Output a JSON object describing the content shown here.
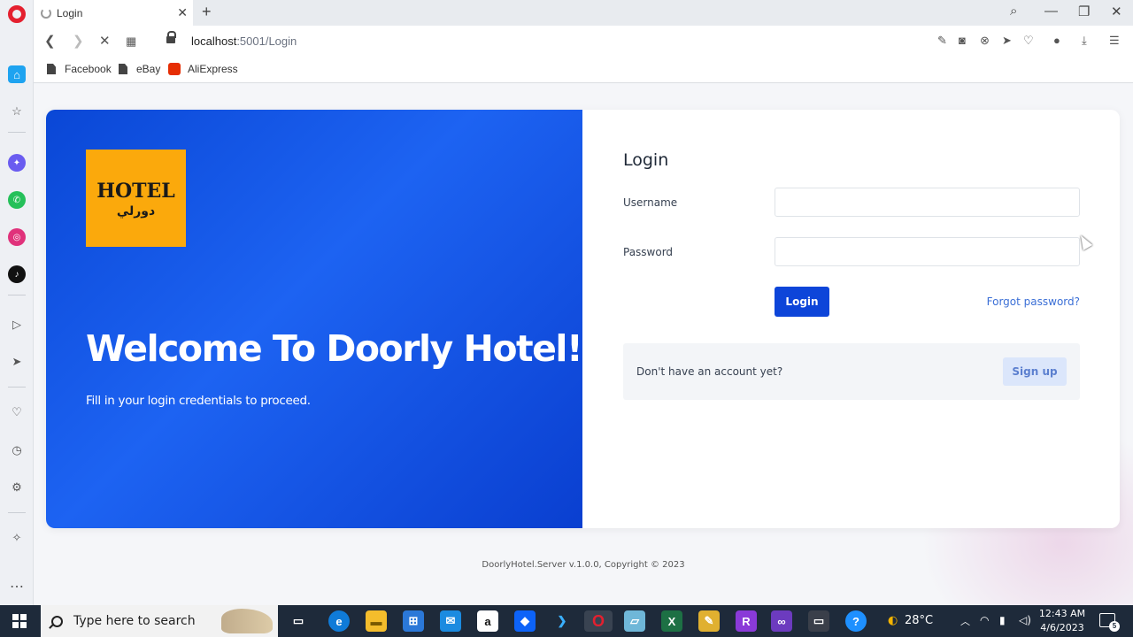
{
  "browser": {
    "tab_title": "Login",
    "url_host": "localhost",
    "url_path": ":5001/Login",
    "bookmarks": [
      "Facebook",
      "eBay",
      "AliExpress"
    ]
  },
  "logo": {
    "text": "HOTEL",
    "arabic": "دورلي"
  },
  "hero": {
    "title": "Welcome To Doorly Hotel!",
    "subtitle": "Fill in your login credentials to proceed."
  },
  "form": {
    "heading": "Login",
    "username_label": "Username",
    "username_value": "",
    "password_label": "Password",
    "password_value": "",
    "login_button": "Login",
    "forgot_link": "Forgot password?",
    "signup_prompt": "Don't have an account yet?",
    "signup_button": "Sign up"
  },
  "footer": "DoorlyHotel.Server v.1.0.0, Copyright © 2023",
  "taskbar": {
    "search_placeholder": "Type here to search",
    "temperature": "28°C",
    "time": "12:43 AM",
    "date": "4/6/2023",
    "notification_count": "5"
  },
  "colors": {
    "hero_blue": "#0a47d6",
    "login_button": "#0d45d9",
    "logo_orange": "#fba90c",
    "link_blue": "#3b6fd6"
  }
}
